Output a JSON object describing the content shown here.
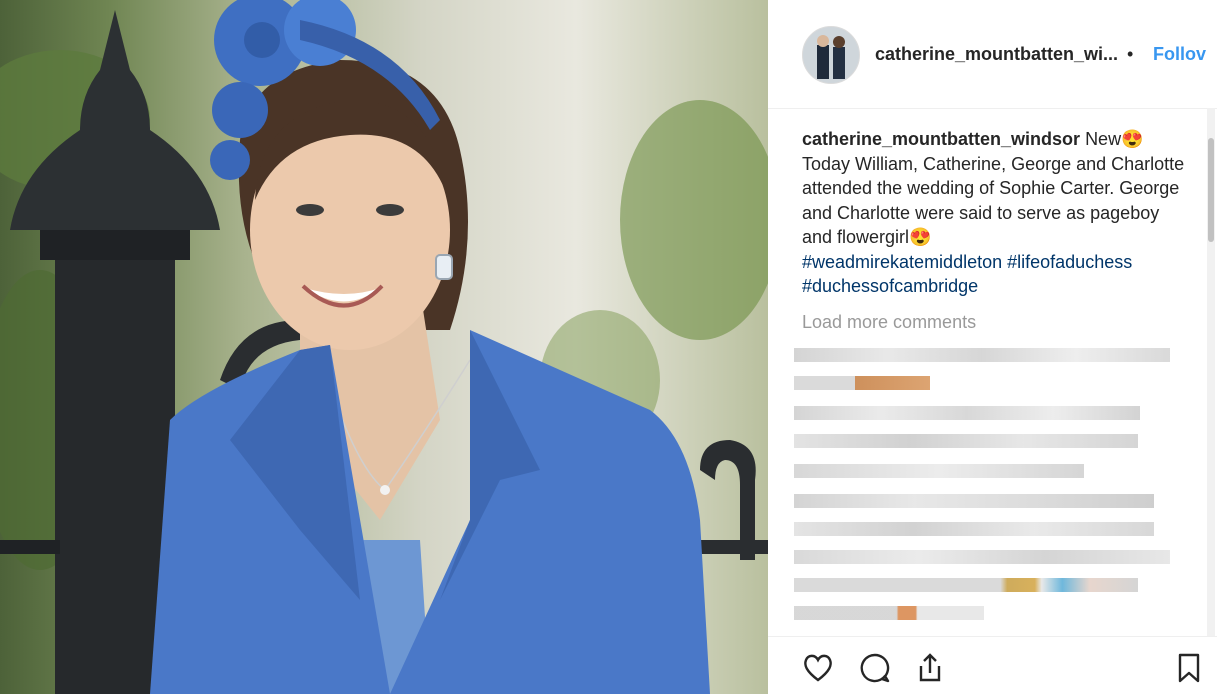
{
  "post": {
    "username": "catherine_mountbatten_wi...",
    "separator": "•",
    "follow_label": "Follov",
    "caption_user": "catherine_mountbatten_windsor",
    "caption_text_1": "New",
    "caption_text_2": "Today William, Catherine, George and Charlotte attended the wedding of Sophie Carter. George and Charlotte were said to serve as pageboy and flowergirl",
    "hashtags": [
      "#weadmirekatemiddleton",
      "#lifeofaduchess",
      "#duchessofcambridge"
    ],
    "emoji_1": "😍",
    "emoji_2": "😍",
    "load_more_label": "Load more comments"
  },
  "icons": {
    "like": "heart-icon",
    "comment": "comment-icon",
    "share": "share-icon",
    "save": "bookmark-icon"
  },
  "colors": {
    "link_blue": "#3897f0",
    "hashtag_blue": "#003569",
    "text": "#262626",
    "muted": "#999999",
    "coat_blue": "#4a78c8"
  }
}
